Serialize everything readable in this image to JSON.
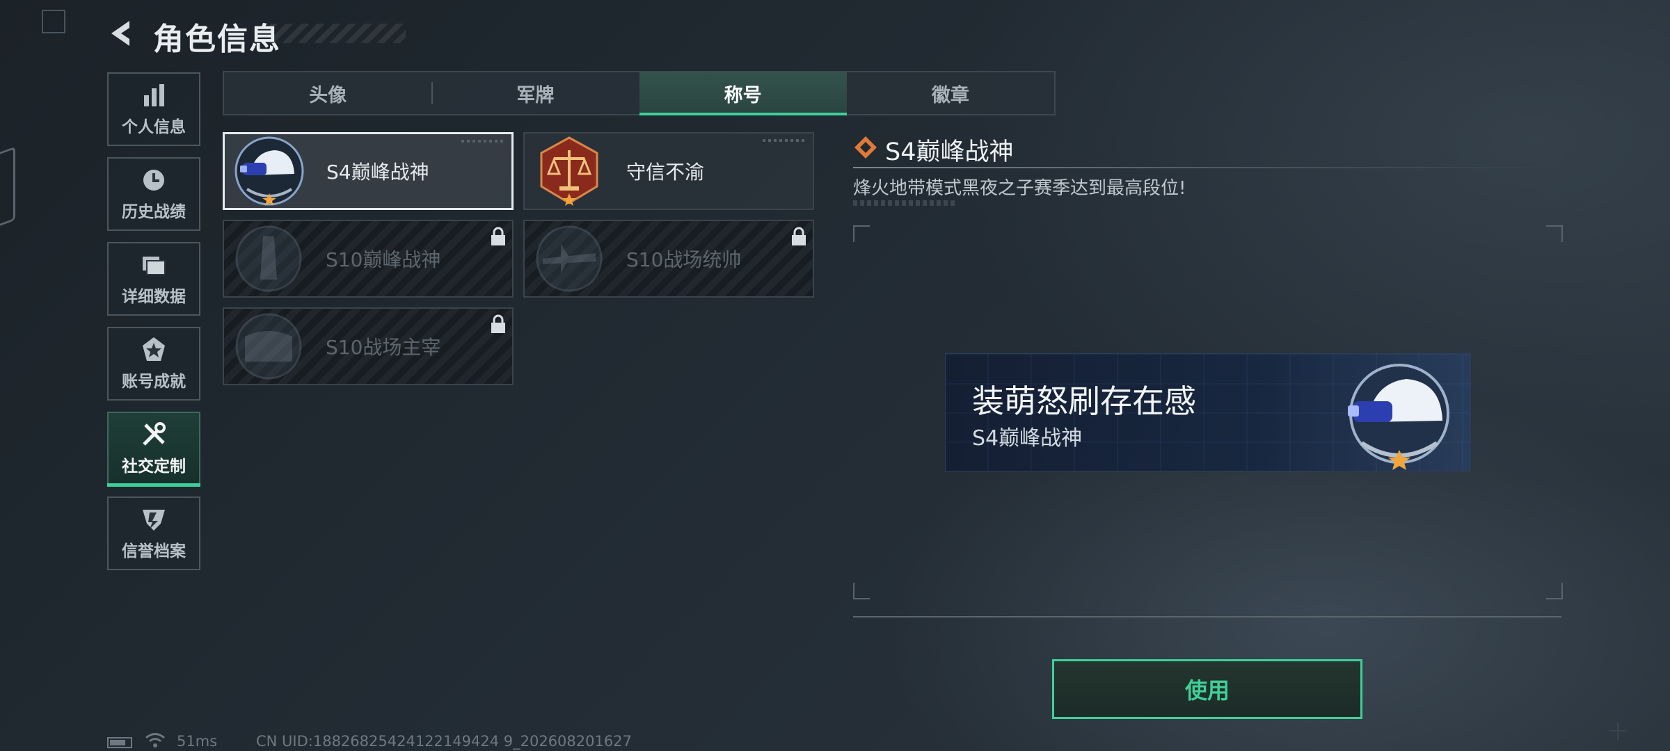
{
  "header": {
    "title": "角色信息"
  },
  "sidebar": {
    "items": [
      {
        "label": "个人信息",
        "icon": "bar-chart-icon"
      },
      {
        "label": "历史战绩",
        "icon": "clock-icon"
      },
      {
        "label": "详细数据",
        "icon": "folder-icon"
      },
      {
        "label": "账号成就",
        "icon": "achievement-icon"
      },
      {
        "label": "社交定制",
        "icon": "tools-icon",
        "active": true
      },
      {
        "label": "信誉档案",
        "icon": "shield-icon"
      }
    ]
  },
  "tabs": [
    {
      "label": "头像"
    },
    {
      "label": "军牌"
    },
    {
      "label": "称号",
      "active": true
    },
    {
      "label": "徽章"
    }
  ],
  "titles": [
    {
      "name": "S4巅峰战神",
      "selected": true,
      "locked": false,
      "icon": "helmet-badge-icon"
    },
    {
      "name": "守信不渝",
      "selected": false,
      "locked": false,
      "icon": "scales-badge-icon"
    },
    {
      "name": "S10巅峰战神",
      "selected": false,
      "locked": true,
      "icon": "tower-badge-icon"
    },
    {
      "name": "S10战场统帅",
      "selected": false,
      "locked": true,
      "icon": "aircraft-badge-icon"
    },
    {
      "name": "S10战场主宰",
      "selected": false,
      "locked": true,
      "icon": "colosseum-badge-icon"
    }
  ],
  "detail": {
    "title": "S4巅峰战神",
    "description": "烽火地带模式黑夜之子赛季达到最高段位!"
  },
  "preview": {
    "player_name": "装萌怒刷存在感",
    "title_name": "S4巅峰战神"
  },
  "use_button": {
    "label": "使用"
  },
  "footer": {
    "ping": "51ms",
    "uid": "CN UID:18826825424122149424 9_202608201627"
  },
  "colors": {
    "accent": "#3fd09a",
    "banner_bg": "#162640"
  }
}
